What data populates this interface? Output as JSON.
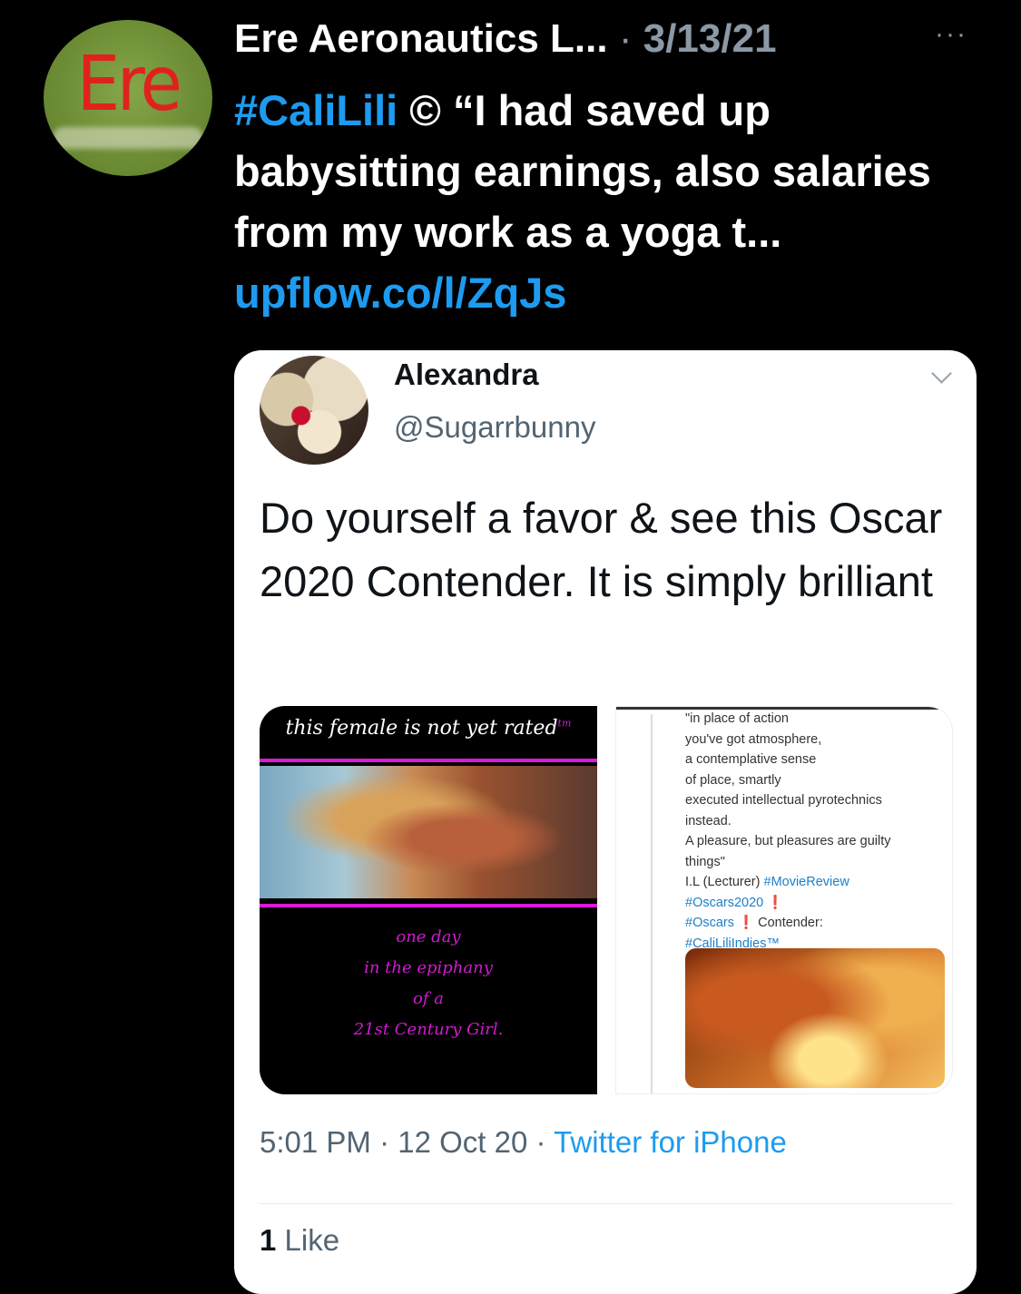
{
  "tweet": {
    "avatar_text": "Ere",
    "author_name": "Ere Aeronautics L...",
    "separator": "·",
    "date": "3/13/21",
    "more_glyph": "···",
    "hashtag": "#CaliLili",
    "body": " © “I had saved up babysitting earnings, also salaries from my work as a yoga t... ",
    "link": "upflow.co/l/ZqJs"
  },
  "quoted": {
    "name": "Alexandra",
    "handle": "@Sugarrbunny",
    "text": "Do yourself a favor & see this Oscar 2020 Contender. It is simply brilliant",
    "media_left": {
      "top_text": "this female is not yet rated",
      "tm": "tm",
      "poem": [
        "one day",
        "in the epiphany",
        "of a",
        "21st Century Girl."
      ]
    },
    "media_right": {
      "lines": [
        "\"in place of action",
        "you've got atmosphere,",
        "a contemplative sense",
        "of place, smartly",
        "executed intellectual pyrotechnics",
        "instead.",
        "A pleasure, but pleasures are guilty",
        "things\""
      ],
      "credit": "I.L (Lecturer) ",
      "tag1": "#MovieReview",
      "tag2": "#Oscars2020",
      "tag2_suffix": " ❗",
      "tag3": "#Oscars",
      "tag3_suffix": " ❗  Contender:",
      "tag4": "#CaliLiliIndies™"
    },
    "time": "5:01 PM",
    "date": "12 Oct 20",
    "dot": " · ",
    "source": "Twitter for iPhone",
    "likes_count": "1",
    "likes_label": " Like"
  }
}
